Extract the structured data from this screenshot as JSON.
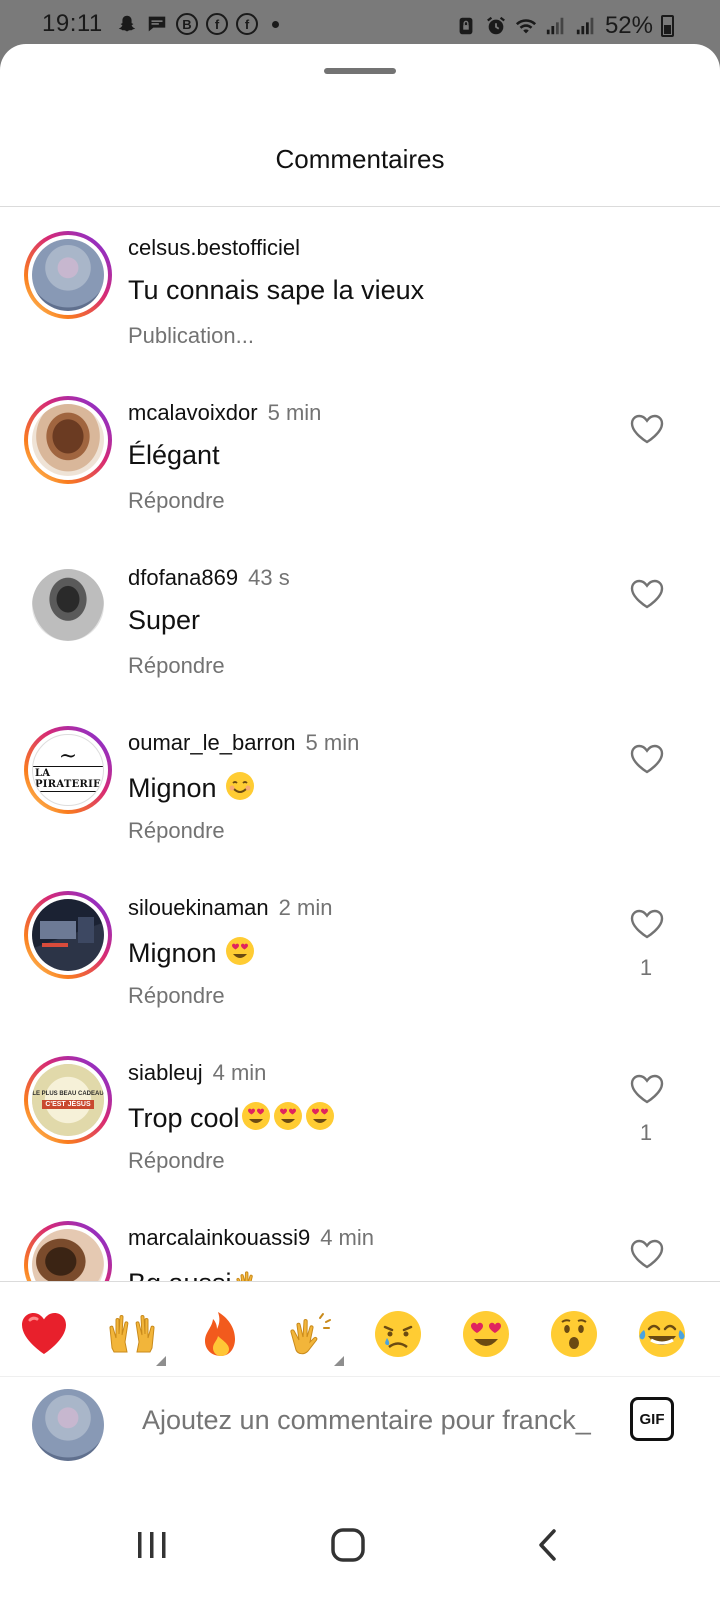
{
  "status_bar": {
    "time": "19:11",
    "battery": "52%",
    "icons": [
      "snapchat-icon",
      "message-icon",
      "b-app-icon",
      "facebook-icon",
      "facebook-icon",
      "dot-icon",
      "alarm-lock-icon",
      "alarm-icon",
      "wifi-icon",
      "signal-icon",
      "signal-icon",
      "battery-icon"
    ]
  },
  "sheet": {
    "title": "Commentaires"
  },
  "comments": [
    {
      "username": "celsus.bestofficiel",
      "time": "",
      "text": "Tu connais sape la vieux",
      "action": "Publication...",
      "likes": "",
      "show_heart": false,
      "avatar": "photo-group",
      "ring": true
    },
    {
      "username": "mcalavoixdor",
      "time": "5 min",
      "text": "Élégant",
      "action": "Répondre",
      "likes": "",
      "show_heart": true,
      "avatar": "face",
      "ring": true
    },
    {
      "username": "dfofana869",
      "time": "43 s",
      "text": "Super",
      "action": "Répondre",
      "likes": "",
      "show_heart": true,
      "avatar": "bw-photo",
      "ring": false
    },
    {
      "username": "oumar_le_barron",
      "time": "5 min",
      "text": "Mignon",
      "emojis": [
        "smiling-face-emoji"
      ],
      "action": "Répondre",
      "likes": "",
      "show_heart": true,
      "avatar": "la-piraterie-logo",
      "ring": true
    },
    {
      "username": "silouekinaman",
      "time": "2 min",
      "text": "Mignon",
      "emojis": [
        "heart-eyes-emoji"
      ],
      "action": "Répondre",
      "likes": "1",
      "show_heart": true,
      "avatar": "dark-screen",
      "ring": true
    },
    {
      "username": "siableuj",
      "time": "4 min",
      "text": "Trop cool",
      "emojis": [
        "heart-eyes-emoji",
        "heart-eyes-emoji",
        "heart-eyes-emoji"
      ],
      "action": "Répondre",
      "likes": "1",
      "show_heart": true,
      "avatar": "poster",
      "ring": true
    },
    {
      "username": "marcalainkouassi9",
      "time": "4 min",
      "text": "Bg aussi",
      "emojis": [
        "clapping-emoji"
      ],
      "action": "",
      "likes": "",
      "show_heart": true,
      "avatar": "photo-selfie",
      "ring": true
    }
  ],
  "logo_text": {
    "la_piraterie": "LA PIRATERIE",
    "poster_line1": "LE PLUS BEAU CADEAU",
    "poster_line2": "C'EST JÉSUS"
  },
  "reactions": [
    {
      "name": "red-heart-emoji",
      "has_variants": false
    },
    {
      "name": "raising-hands-emoji",
      "has_variants": true
    },
    {
      "name": "fire-emoji",
      "has_variants": false
    },
    {
      "name": "clapping-hands-emoji",
      "has_variants": true
    },
    {
      "name": "crying-face-emoji",
      "has_variants": false
    },
    {
      "name": "heart-eyes-emoji",
      "has_variants": false
    },
    {
      "name": "surprised-face-emoji",
      "has_variants": false
    },
    {
      "name": "tears-of-joy-emoji",
      "has_variants": false
    }
  ],
  "composer": {
    "placeholder": "Ajoutez un commentaire pour franck_",
    "gif_label": "GIF"
  },
  "navbar": {
    "buttons": [
      "recents-icon",
      "home-icon",
      "back-icon"
    ]
  }
}
